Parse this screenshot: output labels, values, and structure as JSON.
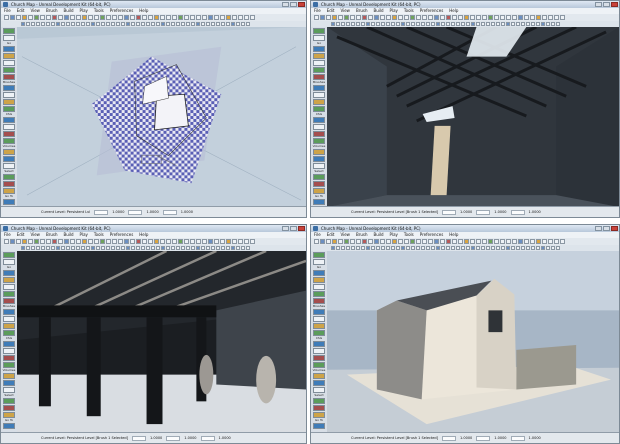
{
  "windows": [
    {
      "title": "Church Map - Unreal Development Kit (64-bit, PC)",
      "menu": [
        "File",
        "Edit",
        "View",
        "Brush",
        "Build",
        "Play",
        "Tools",
        "Preferences",
        "Help"
      ],
      "status": [
        "Current Level: Persistent Lvl",
        "1.0000",
        "1.0000",
        "1.0000"
      ]
    },
    {
      "title": "Church Map - Unreal Development Kit (64-bit, PC)",
      "menu": [
        "File",
        "Edit",
        "View",
        "Brush",
        "Build",
        "Play",
        "Tools",
        "Preferences",
        "Help"
      ],
      "status": [
        "Current Level: Persistent Level [Brush 1 Selected]",
        "1.0000",
        "1.0000",
        "1.0000"
      ]
    },
    {
      "title": "Church Map - Unreal Development Kit (64-bit, PC)",
      "menu": [
        "File",
        "Edit",
        "View",
        "Brush",
        "Build",
        "Play",
        "Tools",
        "Preferences",
        "Help"
      ],
      "status": [
        "Current Level: Persistent Level [Brush 1 Selected]",
        "1.0000",
        "1.0000",
        "1.0000"
      ]
    },
    {
      "title": "Church Map - Unreal Development Kit (64-bit, PC)",
      "menu": [
        "File",
        "Edit",
        "View",
        "Brush",
        "Build",
        "Play",
        "Tools",
        "Preferences",
        "Help"
      ],
      "status": [
        "Current Level: Persistent Level [Brush 1 Selected]",
        "1.0000",
        "1.0000",
        "1.0000"
      ]
    }
  ],
  "sidebar_labels": [
    "Go",
    "Brushes",
    "CSG",
    "Volumes",
    "Select",
    "Go To"
  ],
  "colors": {
    "titlebar": "#c8d6e6",
    "viewport_bg_top": "#b8c7d6",
    "viewport_dark": "#2a2f35",
    "checker_a": "#5a5fb5",
    "checker_b": "#e9e9f3"
  }
}
